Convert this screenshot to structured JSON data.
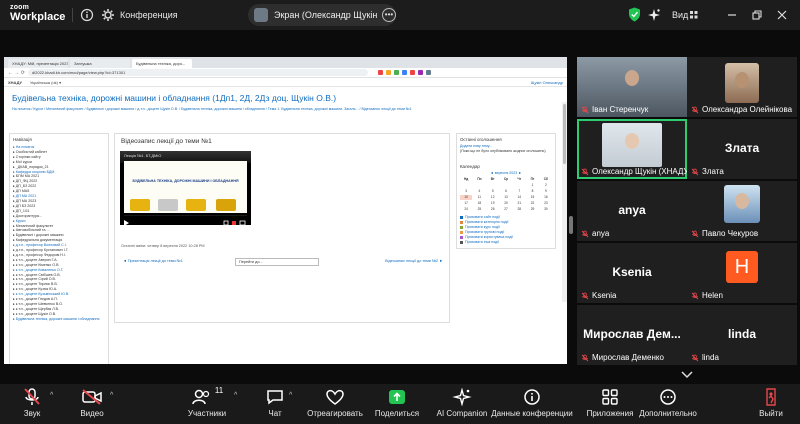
{
  "zoom_topbar": {
    "logo_line1": "zoom",
    "logo_line2": "Workplace",
    "meeting_title": "Конференция",
    "share_label": "Экран (Олександр Щукін (ХНАДУ",
    "view_label": "Вид"
  },
  "shared_screen": {
    "tabs": [
      "ХНАДУ: Мій, презентація 2023",
      "Заглушка",
      "Будівельна техніка, доро..."
    ],
    "address": "dl2022.khadi.kh.com/mod/page/view.php?id=371301",
    "site_name": "ХНАДУ",
    "site_nav_item": "Українська (uk) ▾",
    "user_label": "Щукін Олександр",
    "course_title": "Будівельна техніка, дорожні машини і обладнання (1Дп1, 2Д, 2Дз доц. Щукін О.В.)",
    "breadcrumbs": "На початок / Курси / Механічний факультет / Будівельні і дорожні машини / д.т.н., доцент Щукін О.В. / Будівельна техніка, дорожні машини і обладнання / Тема 1. Будівельна техніка, дорожні машини. Загаль... / Відеозапис лекції до теми №1",
    "left_block": {
      "heading": "Навігація",
      "items": [
        "▸ На початок",
        "▸ Особистий кабінет",
        "▸ Сторінки сайту",
        "▸ Мої курси",
        "  ▸ _ДКАВ_порядок_21",
        "  ▸ Кафедра охорони БДМ",
        "  ▸ БПМ МА 2021",
        "  ▸ ДП_ФЦ 2022",
        "  ▸ ДП_БЗ 2022",
        "  ▸ ДП МА5",
        "  ▸ ДП МА 2021",
        "  ▸ ДП МА 2023",
        "  ▸ ДП БЗ 2023",
        "  ▸ ДП_1/11",
        "  ▸ Докторантура...",
        "▸ Курси",
        "  ▸ Механічний факультет",
        "    ▸ Автомобільний та ...",
        "    ▸ Будівельні і дорожні машини",
        "      ▸ Кафедральна документація",
        "      ▸ д.т.н., професор Волновий С.І.",
        "      ▸ д.т.н., професор Кустанович І.Г.",
        "      ▸ д.т.н., професор Федорові Н.І.",
        "      ▸ к.т.н., доцент Аверин Г.А.",
        "      ▸ к.т.н., доцент Кіменко О.В.",
        "      ▸ к.т.н., доцент Коваленко О.Г.",
        "      ▸ к.т.н., доцент Свібшев О.В.",
        "      ▸ к.т.н., доцент Сірий О.В.",
        "      ▸ к.т.н., доцент Тирлик В.В.",
        "      ▸ к.т.н., доцент Кузюк Ю.А.",
        "      ▸ к.т.н., доцент Кузьмінський Ю.В.",
        "      ▸ к.т.н., доцент Гнєдов А.П.",
        "      ▸ к.т.н., доцент Шевченко В.О.",
        "      ▸ к.т.н., доцент Щербак Л.В.",
        "      ▸ к.т.н., доцент Щукін О.В.",
        "        ▸ Будівельна техніка, дорожні машини і обладнання"
      ]
    },
    "main_block": {
      "title": "Відеозапис лекції до теми №1",
      "video_header": "Лекція №1. БТ,ДМіО",
      "slide_title": "БУДІВЕЛЬНА ТЕХНІКА, ДОРОЖНІ МАШИНИ І ОБЛАДНАННЯ",
      "last_modified": "Останні зміни: четвер 8 вересня 2022 10:28 PM",
      "prev_link": "◄ Презентація лекції до теми №1",
      "jump_select": "Перейти до...",
      "next_link": "Відеозапис лекції до теми №2 ►"
    },
    "right_block": {
      "heading1": "Останні оголошення",
      "news1": "Додати нову тему...",
      "news2": "(Поки що не було опубліковано жодних оголошень)",
      "heading2": "Календар",
      "month": "◄  вересня 2023  ►",
      "weekdays": [
        "Нд",
        "Пн",
        "Вт",
        "Ср",
        "Чт",
        "Пт",
        "Сб"
      ],
      "days": [
        "",
        "",
        "",
        "",
        "",
        "1",
        "2",
        "3",
        "4",
        "5",
        "6",
        "7",
        "8",
        "9",
        "10",
        "11",
        "12",
        "13",
        "14",
        "15",
        "16",
        "17",
        "18",
        "19",
        "20",
        "21",
        "22",
        "23",
        "24",
        "25",
        "26",
        "27",
        "28",
        "29",
        "30"
      ],
      "today_index": 9,
      "legend": [
        "Приховати сайт події",
        "Приховати категорію події",
        "Приховати курс події",
        "Приховати групові події",
        "Приховати користувача події",
        "Приховати інші події"
      ]
    }
  },
  "participants": [
    {
      "name": "Іван Стеренчук",
      "video": true
    },
    {
      "name": "Олександра Олейнікова",
      "video": true
    },
    {
      "name": "Олександр Щукін (ХНАДУ)",
      "video": true,
      "active": true
    },
    {
      "name": "Злата",
      "big": "Злата",
      "video": false
    },
    {
      "name": "anya",
      "big": "anya",
      "video": false
    },
    {
      "name": "Павло Чекуров",
      "video": true
    },
    {
      "name": "Ksenia",
      "big": "Ksenia",
      "video": false
    },
    {
      "name": "Helen",
      "initial": "H",
      "video": false
    },
    {
      "name": "Мирослав Деменко",
      "big": "Мирослав Дем...",
      "video": false
    },
    {
      "name": "linda",
      "big": "linda",
      "video": false
    }
  ],
  "toolbar": {
    "audio": "Звук",
    "video": "Видео",
    "participants": "Участники",
    "participants_count": "11",
    "chat": "Чат",
    "react": "Отреагировать",
    "share": "Поделиться",
    "ai": "AI Companion",
    "info": "Данные конференции",
    "apps": "Приложения",
    "more": "Дополнительно",
    "leave": "Выйти"
  },
  "colors": {
    "accent_green": "#23c552",
    "moodle_blue": "#0f6cbf",
    "mute_red": "#e5484d",
    "helen_orange": "#ff5a1f"
  }
}
